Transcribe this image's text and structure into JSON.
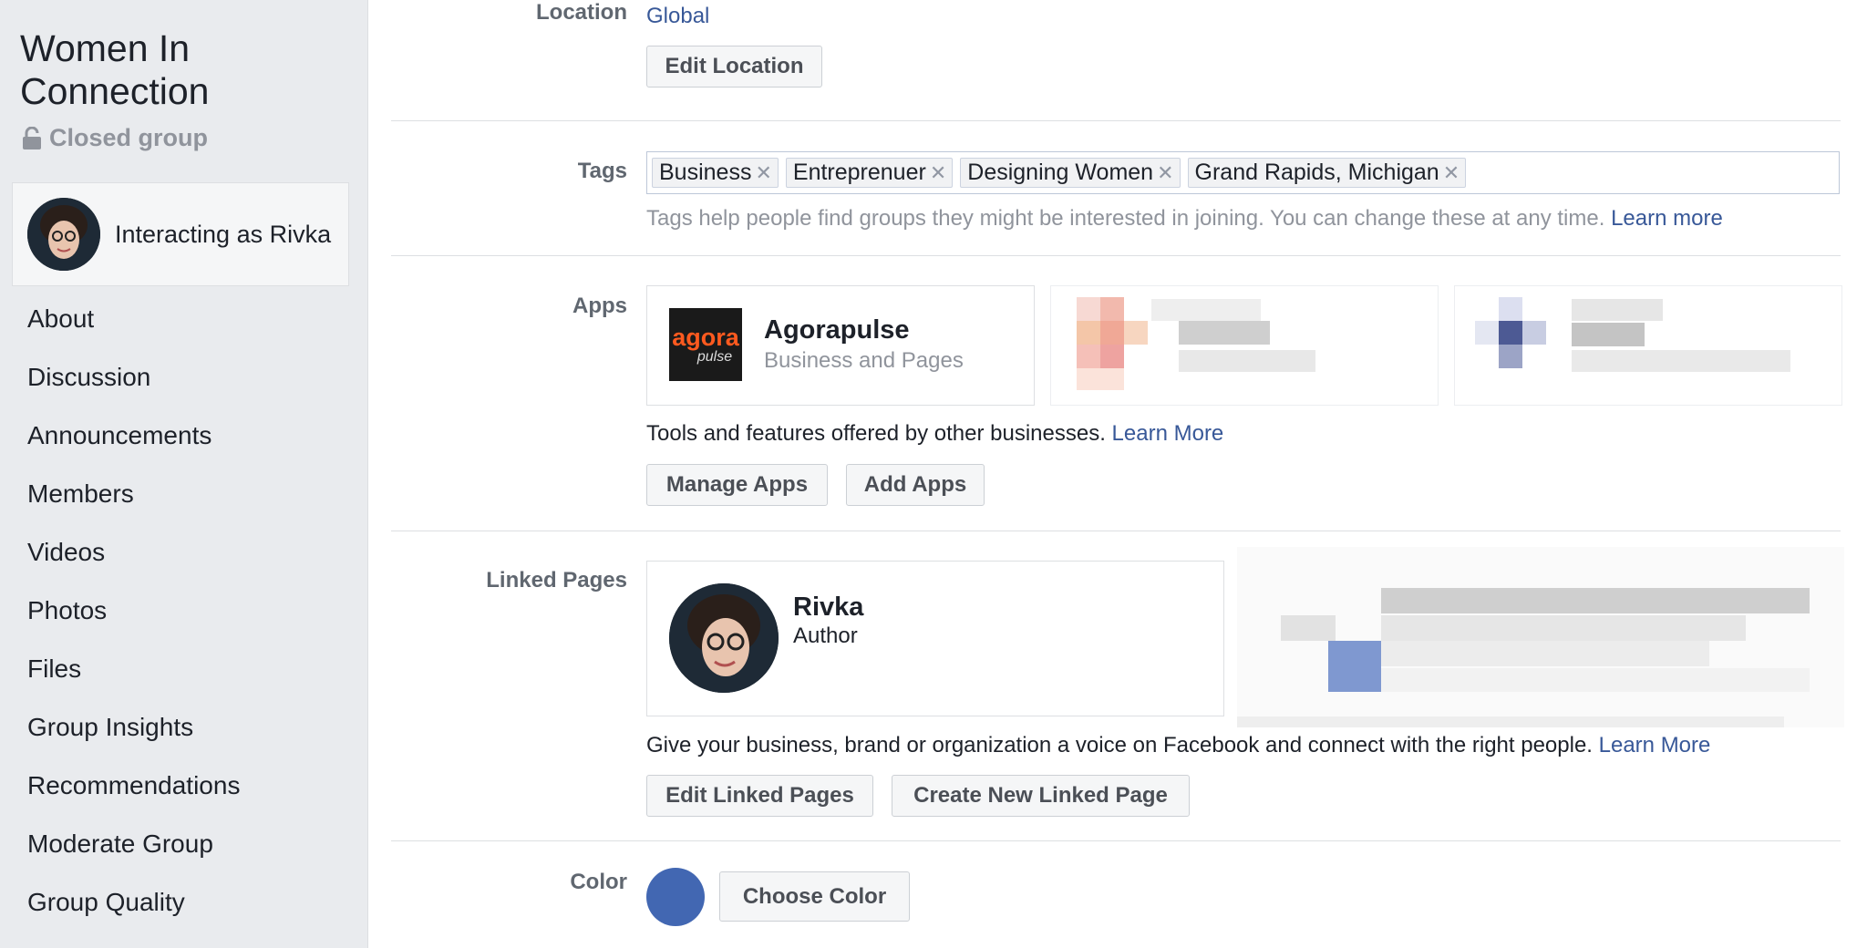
{
  "sidebar": {
    "group_name": "Women In Connection",
    "privacy": "Closed group",
    "interacting_as": "Interacting as Rivka",
    "nav": [
      "About",
      "Discussion",
      "Announcements",
      "Members",
      "Videos",
      "Photos",
      "Files",
      "Group Insights",
      "Recommendations",
      "Moderate Group",
      "Group Quality"
    ]
  },
  "location": {
    "label": "Location",
    "value": "Global",
    "edit_button": "Edit Location"
  },
  "tags": {
    "label": "Tags",
    "items": [
      "Business",
      "Entreprenuer",
      "Designing Women",
      "Grand Rapids, Michigan"
    ],
    "remove_glyph": "✕",
    "help_text": "Tags help people find groups they might be interested in joining. You can change these at any time.",
    "learn_more": "Learn more"
  },
  "apps": {
    "label": "Apps",
    "app_name": "Agorapulse",
    "app_category": "Business and Pages",
    "logo_top": "agora",
    "logo_bottom": "pulse",
    "description": "Tools and features offered by other businesses.",
    "learn_more": "Learn More",
    "manage_button": "Manage Apps",
    "add_button": "Add Apps"
  },
  "linked_pages": {
    "label": "Linked Pages",
    "page_name": "Rivka",
    "page_category": "Author",
    "description": "Give your business, brand or organization a voice on Facebook and connect with the right people.",
    "learn_more": "Learn More",
    "edit_button": "Edit Linked Pages",
    "create_button": "Create New Linked Page"
  },
  "color": {
    "label": "Color",
    "value": "#4267b2",
    "choose_button": "Choose Color"
  },
  "icons": {
    "privacy": "lock-icon",
    "remove_tag": "close-icon"
  }
}
